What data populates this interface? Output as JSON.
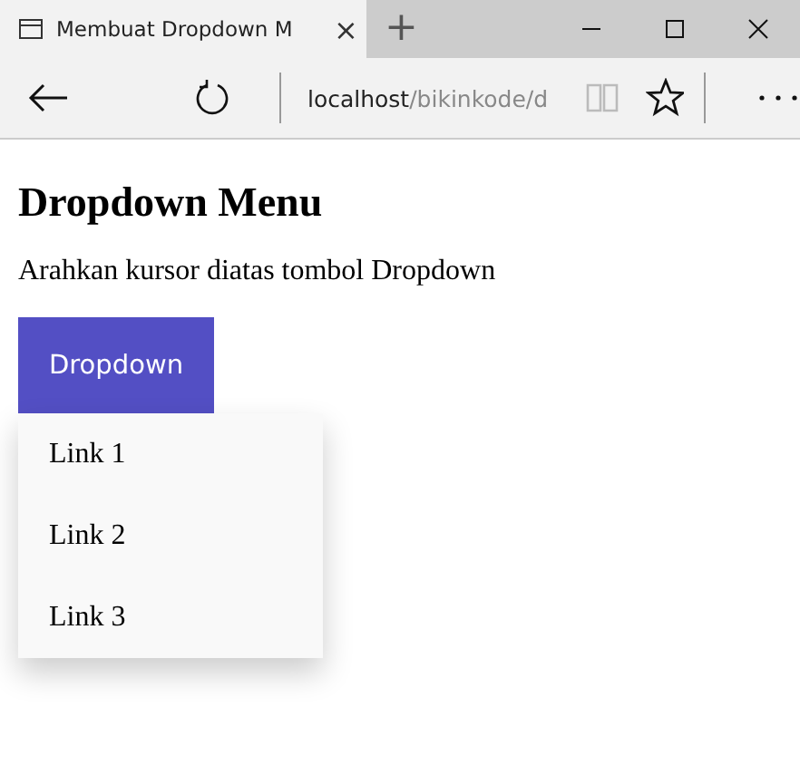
{
  "browser": {
    "tab_title": "Membuat Dropdown M",
    "tab_close": "×",
    "new_tab": "+",
    "address": {
      "host": "localhost",
      "path": "/bikinkode/d"
    }
  },
  "page": {
    "heading": "Dropdown Menu",
    "instruction": "Arahkan kursor diatas tombol Dropdown",
    "button": "Dropdown",
    "menu_open": true,
    "links": [
      "Link 1",
      "Link 2",
      "Link 3"
    ]
  }
}
